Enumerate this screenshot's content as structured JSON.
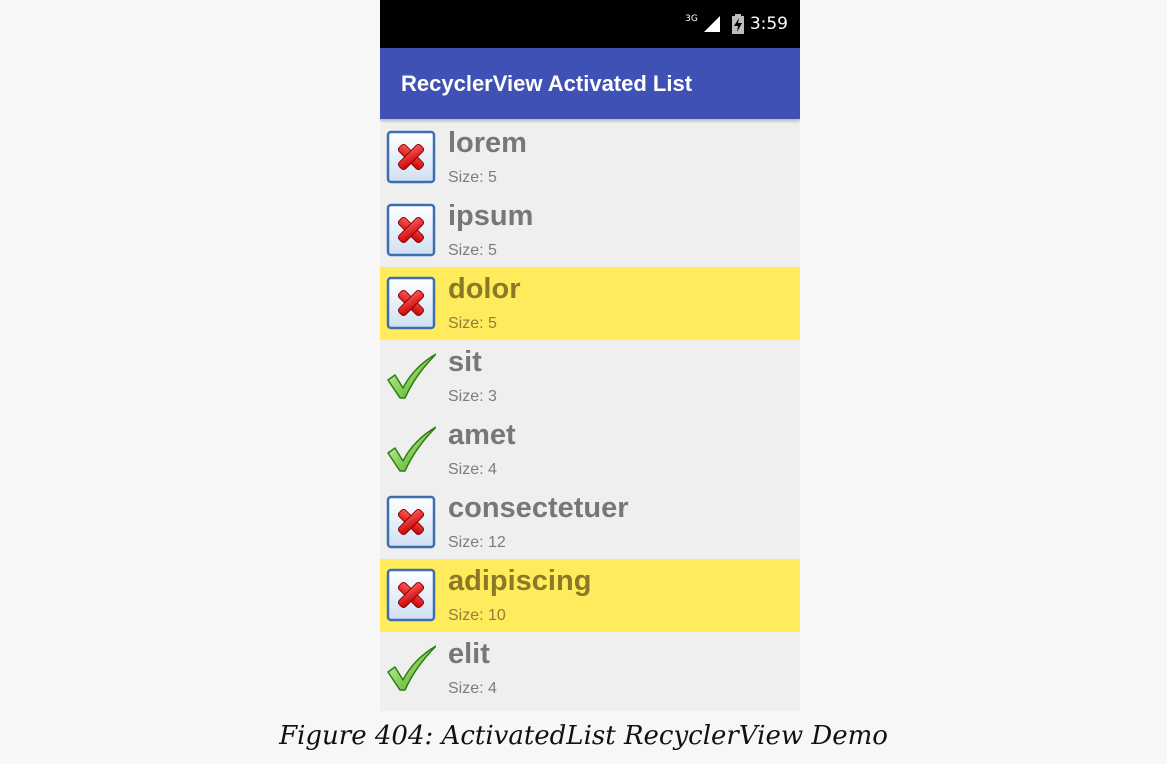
{
  "status_bar": {
    "network": "3G",
    "time": "3:59"
  },
  "app_bar": {
    "title": "RecyclerView Activated List"
  },
  "list": {
    "items": [
      {
        "title": "lorem",
        "size": "Size: 5",
        "icon": "cross-icon",
        "activated": false
      },
      {
        "title": "ipsum",
        "size": "Size: 5",
        "icon": "cross-icon",
        "activated": false
      },
      {
        "title": "dolor",
        "size": "Size: 5",
        "icon": "cross-icon",
        "activated": true
      },
      {
        "title": "sit",
        "size": "Size: 3",
        "icon": "check-icon",
        "activated": false
      },
      {
        "title": "amet",
        "size": "Size: 4",
        "icon": "check-icon",
        "activated": false
      },
      {
        "title": "consectetuer",
        "size": "Size: 12",
        "icon": "cross-icon",
        "activated": false
      },
      {
        "title": "adipiscing",
        "size": "Size: 10",
        "icon": "cross-icon",
        "activated": true
      },
      {
        "title": "elit",
        "size": "Size: 4",
        "icon": "check-icon",
        "activated": false
      }
    ]
  },
  "colors": {
    "app_bar": "#3f51b5",
    "activated_row": "#ffeb5c",
    "list_background": "#efefef"
  },
  "caption": "Figure 404: ActivatedList RecyclerView Demo"
}
